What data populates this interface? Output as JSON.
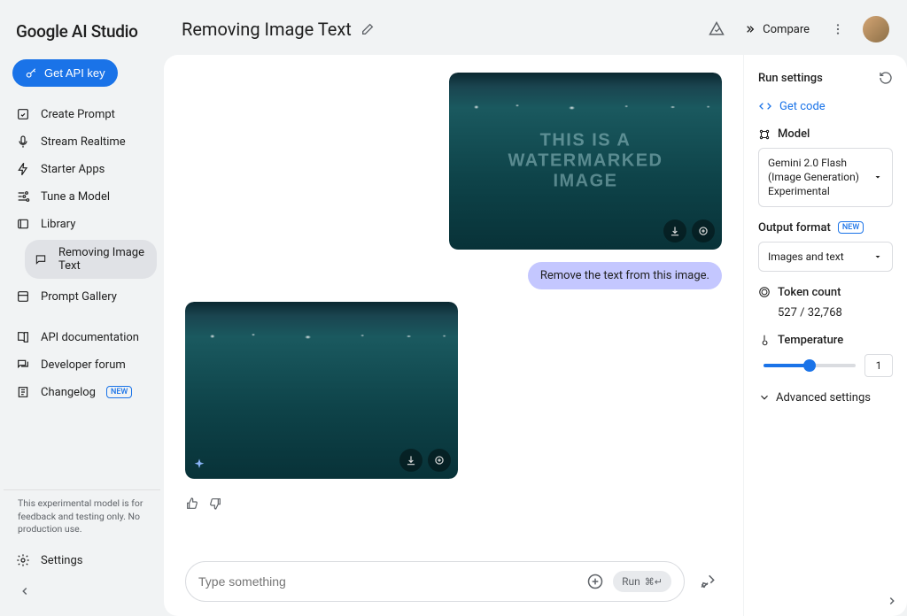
{
  "app": {
    "name": "Google AI Studio"
  },
  "sidebar": {
    "apiKeyLabel": "Get API key",
    "items": [
      {
        "label": "Create Prompt",
        "icon": "edit-square-icon"
      },
      {
        "label": "Stream Realtime",
        "icon": "mic-icon"
      },
      {
        "label": "Starter Apps",
        "icon": "bolt-icon"
      },
      {
        "label": "Tune a Model",
        "icon": "tune-icon"
      },
      {
        "label": "Library",
        "icon": "library-icon"
      }
    ],
    "subItem": {
      "label": "Removing Image Text"
    },
    "promptGallery": "Prompt Gallery",
    "docs": [
      {
        "label": "API documentation",
        "icon": "book-icon"
      },
      {
        "label": "Developer forum",
        "icon": "forum-icon"
      },
      {
        "label": "Changelog",
        "icon": "log-icon",
        "badge": "NEW"
      }
    ],
    "disclaimer": "This experimental model is for feedback and testing only. No production use.",
    "settings": "Settings"
  },
  "topbar": {
    "title": "Removing Image Text",
    "compare": "Compare"
  },
  "chat": {
    "watermarkLine1": "THIS IS A",
    "watermarkLine2": "WATERMARKED",
    "watermarkLine3": "IMAGE",
    "userMsg": "Remove the text from this image.",
    "placeholder": "Type something",
    "runLabel": "Run",
    "shortcut": "⌘↵"
  },
  "settings": {
    "title": "Run settings",
    "getCode": "Get code",
    "modelLabel": "Model",
    "modelValue": "Gemini 2.0 Flash (Image Generation) Experimental",
    "outputLabel": "Output format",
    "outputBadge": "NEW",
    "outputValue": "Images and text",
    "tokenLabel": "Token count",
    "tokenValue": "527 / 32,768",
    "tempLabel": "Temperature",
    "tempValue": "1",
    "advanced": "Advanced settings"
  }
}
